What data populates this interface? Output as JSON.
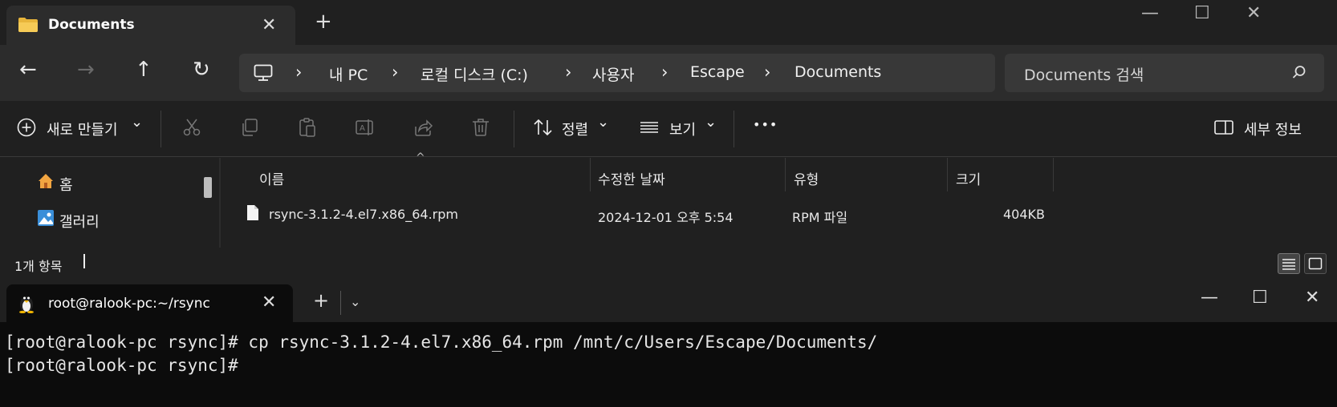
{
  "explorer": {
    "tab": {
      "title": "Documents",
      "close": "✕"
    },
    "new_tab": "+",
    "window_controls": {
      "minimize": "—",
      "maximize": "☐",
      "close": "✕"
    },
    "nav": {
      "back": "←",
      "forward": "→",
      "up": "↑",
      "refresh": "↻"
    },
    "breadcrumb": [
      "내 PC",
      "로컬 디스크 (C:)",
      "사용자",
      "Escape",
      "Documents"
    ],
    "breadcrumb_sep": "›",
    "search": {
      "placeholder": "Documents 검색"
    },
    "commands": {
      "new": "새로 만들기",
      "sort": "정렬",
      "view": "보기",
      "more": "•••",
      "details": "세부 정보",
      "chevron": "⌄"
    },
    "sidebar": {
      "items": [
        {
          "label": "홈"
        },
        {
          "label": "갤러리"
        }
      ]
    },
    "columns": {
      "name": "이름",
      "modified": "수정한 날짜",
      "type": "유형",
      "size": "크기"
    },
    "sort_caret": "^",
    "files": [
      {
        "name": "rsync-3.1.2-4.el7.x86_64.rpm",
        "modified": "2024-12-01 오후 5:54",
        "type": "RPM 파일",
        "size": "404KB"
      }
    ],
    "status": {
      "count": "1개 항목"
    }
  },
  "terminal": {
    "tab": {
      "title": "root@ralook-pc:~/rsync",
      "close": "✕"
    },
    "new_tab": "+",
    "dropdown": "⌄",
    "window_controls": {
      "minimize": "—",
      "maximize": "☐",
      "close": "✕"
    },
    "lines": [
      "[root@ralook-pc rsync]# cp rsync-3.1.2-4.el7.x86_64.rpm /mnt/c/Users/Escape/Documents/",
      "[root@ralook-pc rsync]#"
    ]
  }
}
